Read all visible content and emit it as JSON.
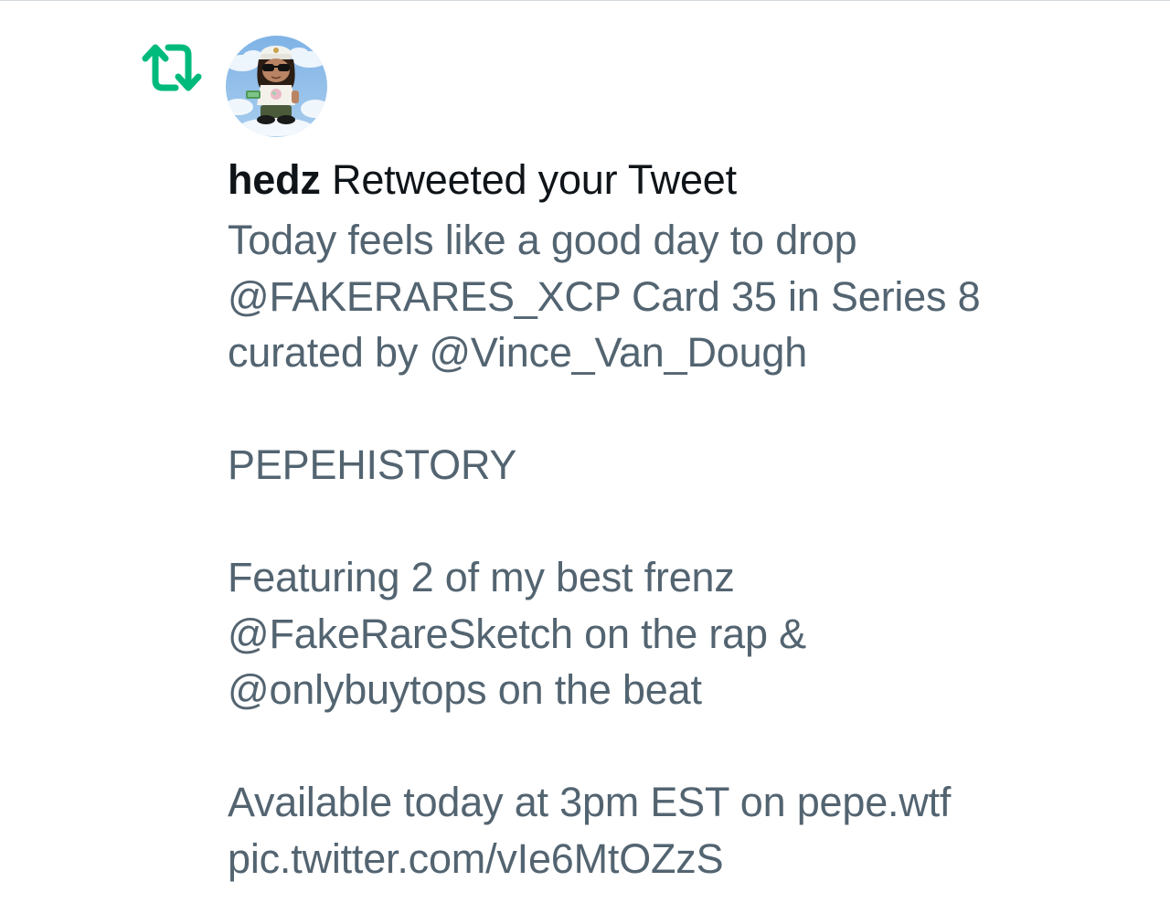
{
  "notification": {
    "icon": "retweet-icon",
    "avatar": "user-avatar",
    "user_name": "hedz",
    "action_text": "Retweeted your Tweet",
    "tweet_lines": [
      "Today feels like a good day to drop",
      "@FAKERARES_XCP Card 35 in Series 8",
      "curated by @Vince_Van_Dough",
      "",
      "PEPEHISTORY",
      "",
      "Featuring 2 of my best frenz",
      "@FakeRareSketch on the rap &",
      "@onlybuytops on the beat",
      "",
      "Available today at 3pm EST on pepe.wtf",
      "pic.twitter.com/vIe6MtOZzS"
    ]
  },
  "colors": {
    "retweet_green": "#00ba7c",
    "name_text": "#0f1419",
    "body_text": "#536471",
    "divider": "#d3d9de"
  }
}
